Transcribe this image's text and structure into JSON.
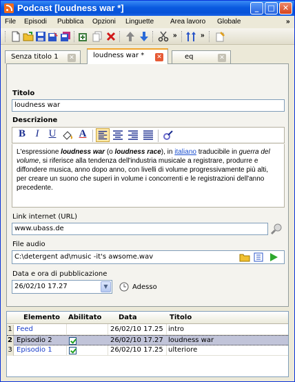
{
  "window": {
    "title": "Podcast [loudness war *]"
  },
  "menu": [
    "File",
    "Episodi",
    "Pubblica",
    "Opzioni",
    "Linguette",
    "Area lavoro",
    "Globale",
    "»"
  ],
  "toolbar": {
    "overflow1": "»",
    "overflow2": "»"
  },
  "tabs": [
    {
      "label": "Senza titolo 1"
    },
    {
      "label": "loudness war *"
    },
    {
      "label": "eq"
    }
  ],
  "form": {
    "titolo_label": "Titolo",
    "titolo_value": "loudness war",
    "descrizione_label": "Descrizione",
    "description": {
      "p1": "L'espressione ",
      "b1": "loudness war",
      "p2": " (o ",
      "b2": "loudness race",
      "p3": "), in ",
      "link": "italiano",
      "p4": " traducibile in ",
      "i1": "guerra del volume",
      "p5": ", si riferisce alla tendenza dell'industria musicale a registrare, produrre e diffondere musica, anno dopo anno, con livelli di volume progressivamente più alti, per creare un suono che superi in volume i concorrenti e le registrazioni dell'anno precedente."
    },
    "link_label": "Link internet (URL)",
    "link_value": "www.ubass.de",
    "audio_label": "File audio",
    "audio_value": "C:\\detergent ad\\music -it's awsome.wav",
    "date_label": "Data e ora di pubblicazione",
    "date_value": "26/02/10 17.27",
    "now_label": "Adesso"
  },
  "table": {
    "columns": [
      "Elemento",
      "Abilitato",
      "Data",
      "Titolo"
    ],
    "rows": [
      {
        "num": "1",
        "elemento": "Feed",
        "abilitato": false,
        "data": "26/02/10 17.25",
        "titolo": "intro"
      },
      {
        "num": "2",
        "elemento": "Episodio 2",
        "abilitato": true,
        "data": "26/02/10 17.27",
        "titolo": "loudness war"
      },
      {
        "num": "3",
        "elemento": "Episodio 1",
        "abilitato": true,
        "data": "26/02/10 17.25",
        "titolo": "ulteriore"
      }
    ]
  },
  "colors": {
    "accent": "#0a5ae0",
    "tab_highlight": "#f1a32a",
    "link": "#1a4fcf",
    "selection": "#c1c4d9"
  }
}
